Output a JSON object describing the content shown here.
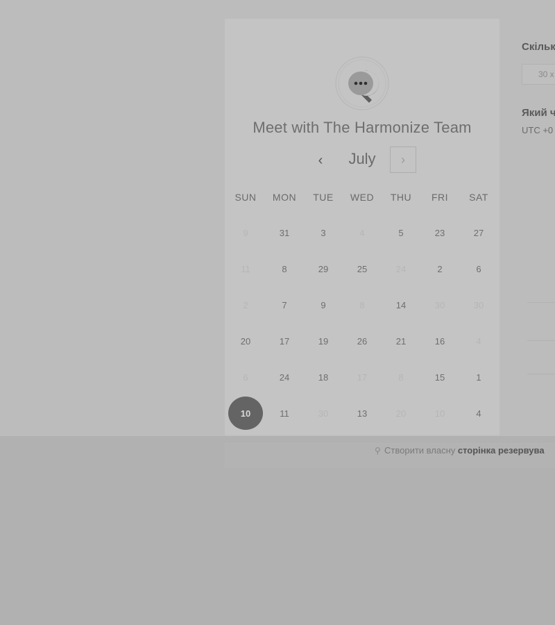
{
  "title": "Meet with The Harmonize Team",
  "calendar": {
    "month": "July",
    "prev_label": "‹",
    "next_label": "›",
    "weekdays": [
      "SUN",
      "MON",
      "TUE",
      "WED",
      "THU",
      "FRI",
      "SAT"
    ],
    "weeks": [
      [
        {
          "d": "9",
          "disabled": true
        },
        {
          "d": "31",
          "disabled": false
        },
        {
          "d": "3",
          "disabled": false
        },
        {
          "d": "4",
          "disabled": true
        },
        {
          "d": "5",
          "disabled": false
        },
        {
          "d": "23",
          "disabled": false
        },
        {
          "d": "27",
          "disabled": false
        }
      ],
      [
        {
          "d": "11",
          "disabled": true
        },
        {
          "d": "8",
          "disabled": false
        },
        {
          "d": "29",
          "disabled": false
        },
        {
          "d": "25",
          "disabled": false
        },
        {
          "d": "24",
          "disabled": true
        },
        {
          "d": "2",
          "disabled": false
        },
        {
          "d": "6",
          "disabled": false
        }
      ],
      [
        {
          "d": "2",
          "disabled": true
        },
        {
          "d": "7",
          "disabled": false
        },
        {
          "d": "9",
          "disabled": false
        },
        {
          "d": "8",
          "disabled": true
        },
        {
          "d": "14",
          "disabled": false
        },
        {
          "d": "30",
          "disabled": true
        },
        {
          "d": "30",
          "disabled": true
        }
      ],
      [
        {
          "d": "20",
          "disabled": false
        },
        {
          "d": "17",
          "disabled": false
        },
        {
          "d": "19",
          "disabled": false
        },
        {
          "d": "26",
          "disabled": false
        },
        {
          "d": "21",
          "disabled": false
        },
        {
          "d": "16",
          "disabled": false
        },
        {
          "d": "4",
          "disabled": true
        }
      ],
      [
        {
          "d": "6",
          "disabled": true
        },
        {
          "d": "24",
          "disabled": false
        },
        {
          "d": "18",
          "disabled": false
        },
        {
          "d": "17",
          "disabled": true
        },
        {
          "d": "8",
          "disabled": true
        },
        {
          "d": "15",
          "disabled": false
        },
        {
          "d": "1",
          "disabled": false
        }
      ],
      [
        {
          "d": "10",
          "disabled": false,
          "selected": true
        },
        {
          "d": "11",
          "disabled": false
        },
        {
          "d": "30",
          "disabled": true
        },
        {
          "d": "13",
          "disabled": false
        },
        {
          "d": "20",
          "disabled": true
        },
        {
          "d": "10",
          "disabled": true
        },
        {
          "d": "4",
          "disabled": false
        }
      ]
    ]
  },
  "sidebar": {
    "duration_label": "Скільк",
    "duration_value": "30 х",
    "time_label": "Який ч",
    "timezone": "UTC +0"
  },
  "footer": {
    "text": "Створити власну ",
    "bold": "сторінка резервува"
  },
  "icons": {
    "logo": "chat-bubble-logo-icon",
    "footer": "hubspot-sprocket-icon"
  },
  "colors": {
    "selected_day": "#646464",
    "panel": "#c4c4c4"
  }
}
